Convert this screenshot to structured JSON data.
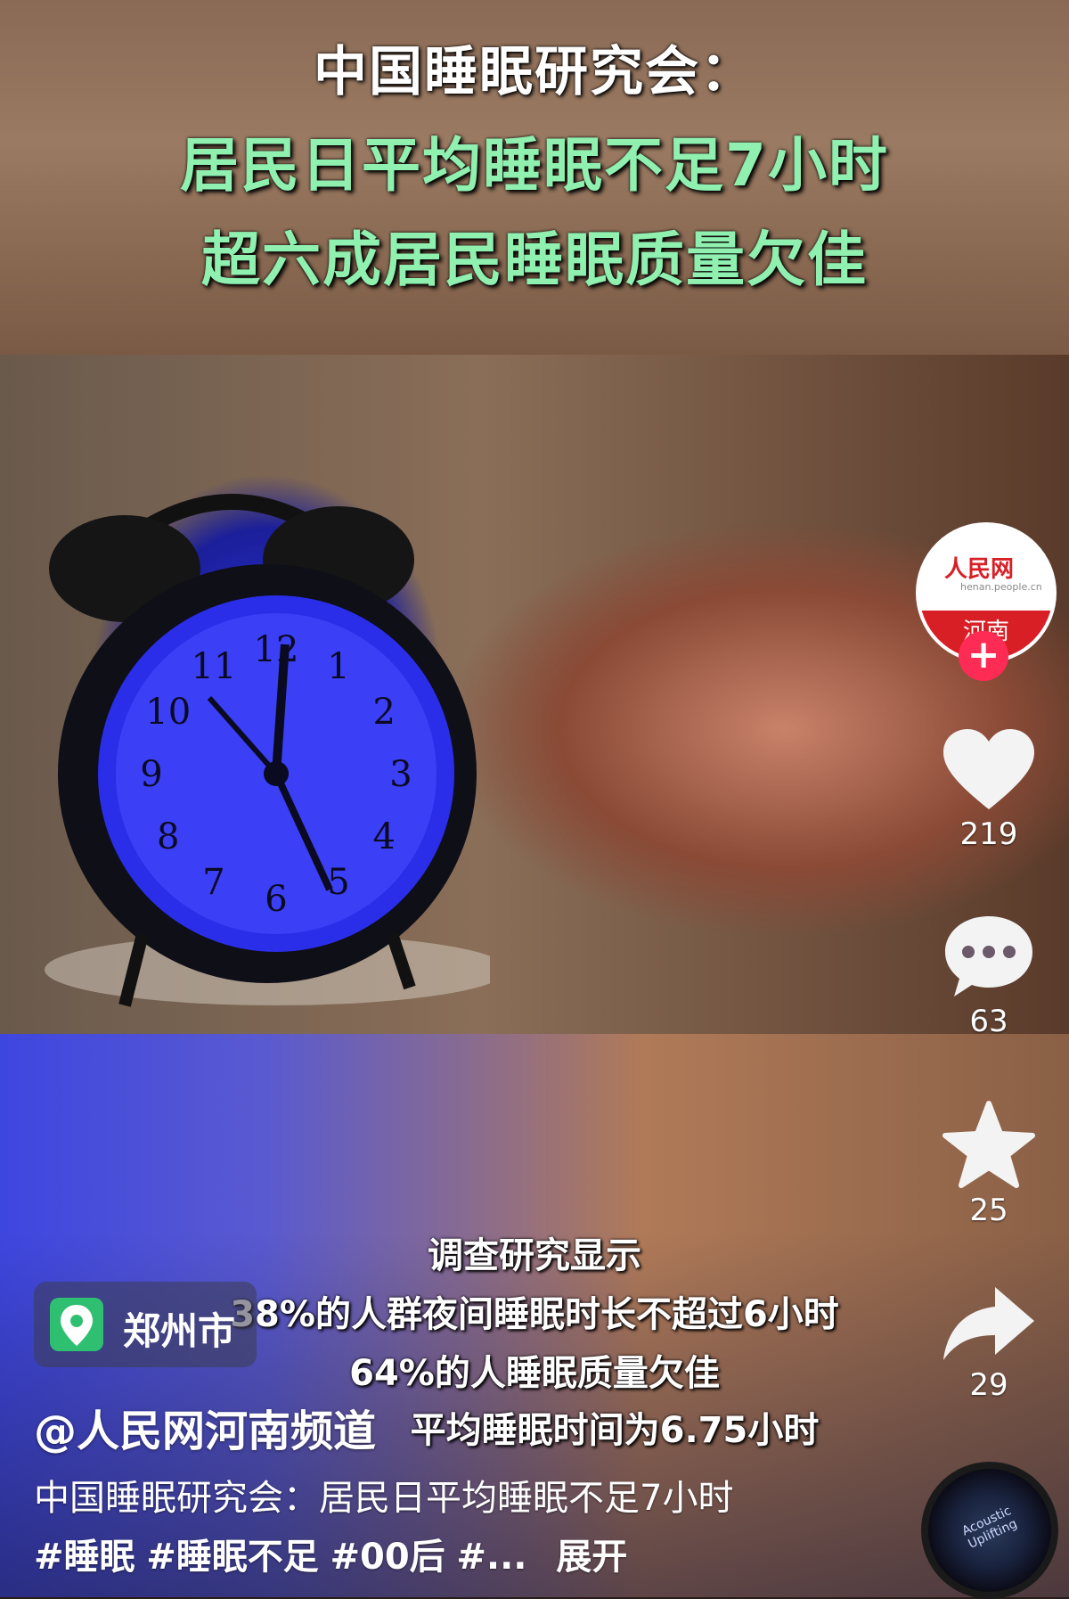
{
  "header": {
    "line1": "中国睡眠研究会：",
    "line2": "居民日平均睡眠不足7小时",
    "line3": "超六成居民睡眠质量欠佳"
  },
  "clock": {
    "numerals": [
      "12",
      "1",
      "2",
      "3",
      "4",
      "5",
      "6",
      "7",
      "8",
      "9",
      "10",
      "11"
    ]
  },
  "overlay": {
    "line1": "调查研究显示",
    "line2": "38%的人群夜间睡眠时长不超过6小时",
    "line3": "64%的人睡眠质量欠佳",
    "line4": "平均睡眠时间为6.75小时"
  },
  "account": {
    "brand": "人民网",
    "url": "henan.people.cn",
    "region": "河南",
    "follow": "+"
  },
  "actions": {
    "likes": "219",
    "comments": "63",
    "favorites": "25",
    "shares": "29"
  },
  "location": {
    "label": "郑州市"
  },
  "author": "@人民网河南频道",
  "description": {
    "text": "中国睡眠研究会：居民日平均睡眠不足7小时",
    "tags": [
      "#睡眠",
      "#睡眠不足",
      "#00后",
      "#..."
    ],
    "expand": "展开"
  },
  "music": {
    "label": "Acoustic Uplifting"
  }
}
